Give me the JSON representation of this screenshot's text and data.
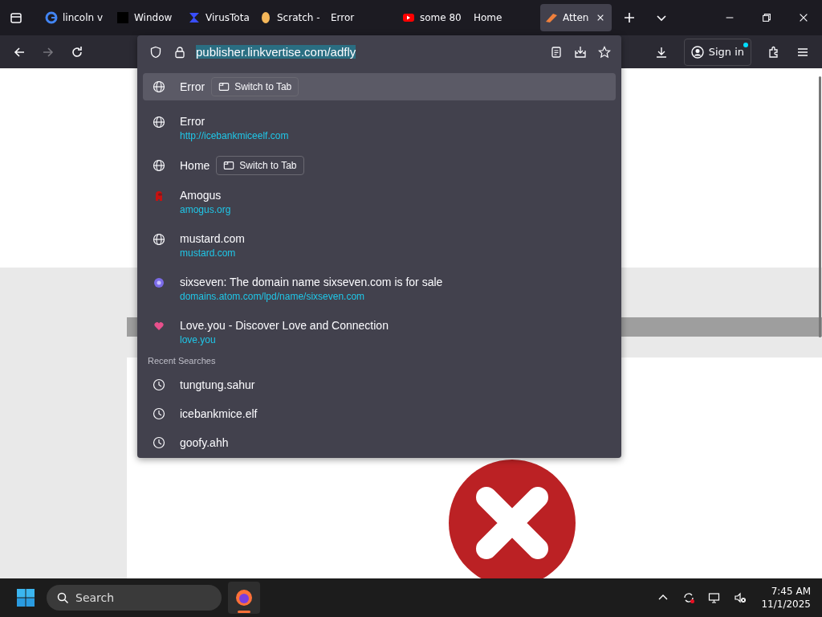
{
  "tabs": [
    {
      "title": "lincoln v",
      "selected": false
    },
    {
      "title": "Window",
      "selected": false
    },
    {
      "title": "VirusTota",
      "selected": false
    },
    {
      "title": "Scratch -",
      "selected": false
    },
    {
      "title": "Error",
      "selected": false
    },
    {
      "title": "some 80",
      "selected": false
    },
    {
      "title": "Home",
      "selected": false
    },
    {
      "title": "Atten",
      "selected": true
    }
  ],
  "toolbar": {
    "url": "publisher.linkvertise.com/adfly",
    "sign_in": "Sign in"
  },
  "suggestions": [
    {
      "kind": "tab",
      "title": "Error",
      "action": "Switch to Tab",
      "selected": true
    },
    {
      "kind": "history",
      "title": "Error",
      "url": "http://icebankmiceelf.com",
      "selected": false
    },
    {
      "kind": "tab",
      "title": "Home",
      "action": "Switch to Tab",
      "selected": false
    },
    {
      "kind": "history",
      "title": "Amogus",
      "url": "amogus.org",
      "selected": false
    },
    {
      "kind": "history",
      "title": "mustard.com",
      "url": "mustard.com",
      "selected": false
    },
    {
      "kind": "history",
      "title": "sixseven: The domain name sixseven.com is for sale",
      "url": "domains.atom.com/lpd/name/sixseven.com",
      "selected": false
    },
    {
      "kind": "history",
      "title": "Love.you - Discover Love and Connection",
      "url": "love.you",
      "selected": false
    }
  ],
  "recent_searches": {
    "heading": "Recent Searches",
    "items": [
      "tungtung.sahur",
      "icebankmice.elf",
      "goofy.ahh"
    ]
  },
  "taskbar": {
    "search_placeholder": "Search",
    "time": "7:45 AM",
    "date": "11/1/2025"
  }
}
